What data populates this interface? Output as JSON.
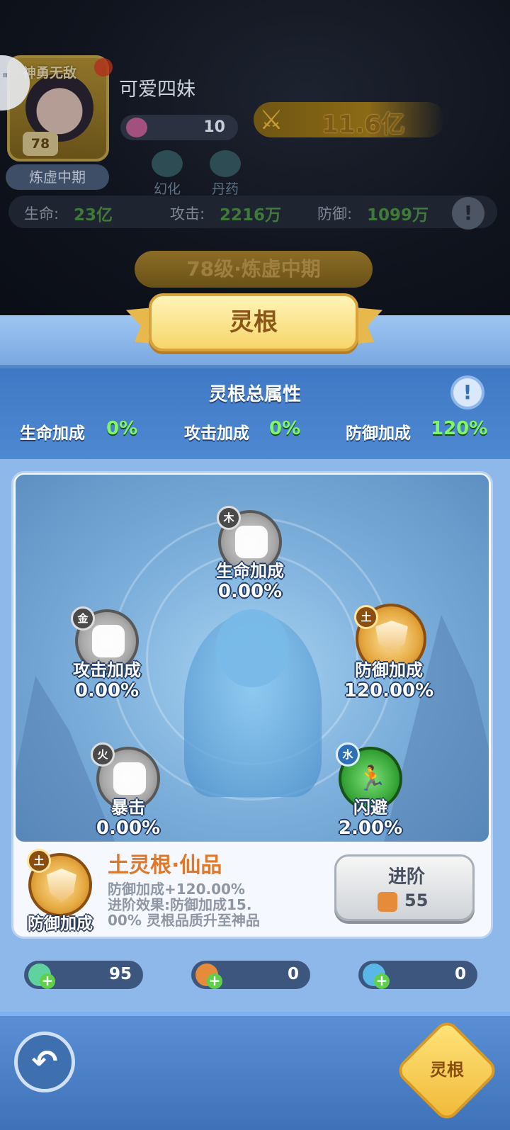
{
  "player": {
    "avatar_title": "神勇无敌",
    "level": "78",
    "realm": "炼虚中期",
    "name": "可爱四妹",
    "gems": "10",
    "power": "11.6亿",
    "features": [
      "幻化",
      "丹药"
    ],
    "stats": [
      {
        "label": "生命:",
        "value": "23亿"
      },
      {
        "label": "攻击:",
        "value": "2216万"
      },
      {
        "label": "防御:",
        "value": "1099万"
      }
    ],
    "level_banner": "78级·炼虚中期"
  },
  "panel": {
    "title": "灵根",
    "summary_title": "灵根总属性",
    "summary": [
      {
        "label": "生命加成",
        "value": "0%"
      },
      {
        "label": "攻击加成",
        "value": "0%"
      },
      {
        "label": "防御加成",
        "value": "120%"
      }
    ],
    "nodes": [
      {
        "element": "木",
        "label": "生命加成",
        "value": "0.00%",
        "icon": "heart-plus-icon",
        "state": "locked"
      },
      {
        "element": "金",
        "label": "攻击加成",
        "value": "0.00%",
        "icon": "sword-icon",
        "state": "locked"
      },
      {
        "element": "土",
        "label": "防御加成",
        "value": "120.00%",
        "icon": "shield-icon",
        "state": "active"
      },
      {
        "element": "火",
        "label": "暴击",
        "value": "0.00%",
        "icon": "crit-icon",
        "state": "locked"
      },
      {
        "element": "水",
        "label": "闪避",
        "value": "2.00%",
        "icon": "dodge-runner-icon",
        "state": "active"
      }
    ],
    "selected": {
      "element": "土",
      "label": "防御加成",
      "name": "土灵根·仙品",
      "line1": "防御加成+120.00%",
      "line2": "进阶效果:防御加成15.",
      "line3": "00% 灵根品质升至神品"
    },
    "advance": {
      "label": "进阶",
      "cost": "55"
    },
    "resources": [
      {
        "icon": "green-gem-icon",
        "value": "95"
      },
      {
        "icon": "orange-gem-icon",
        "value": "0"
      },
      {
        "icon": "blue-gem-icon",
        "value": "0"
      }
    ],
    "bottom_button": "灵根"
  },
  "colors": {
    "positive": "#7ef56c",
    "accent_orange": "#e0782a",
    "panel_blue": "#8eb8ea"
  }
}
